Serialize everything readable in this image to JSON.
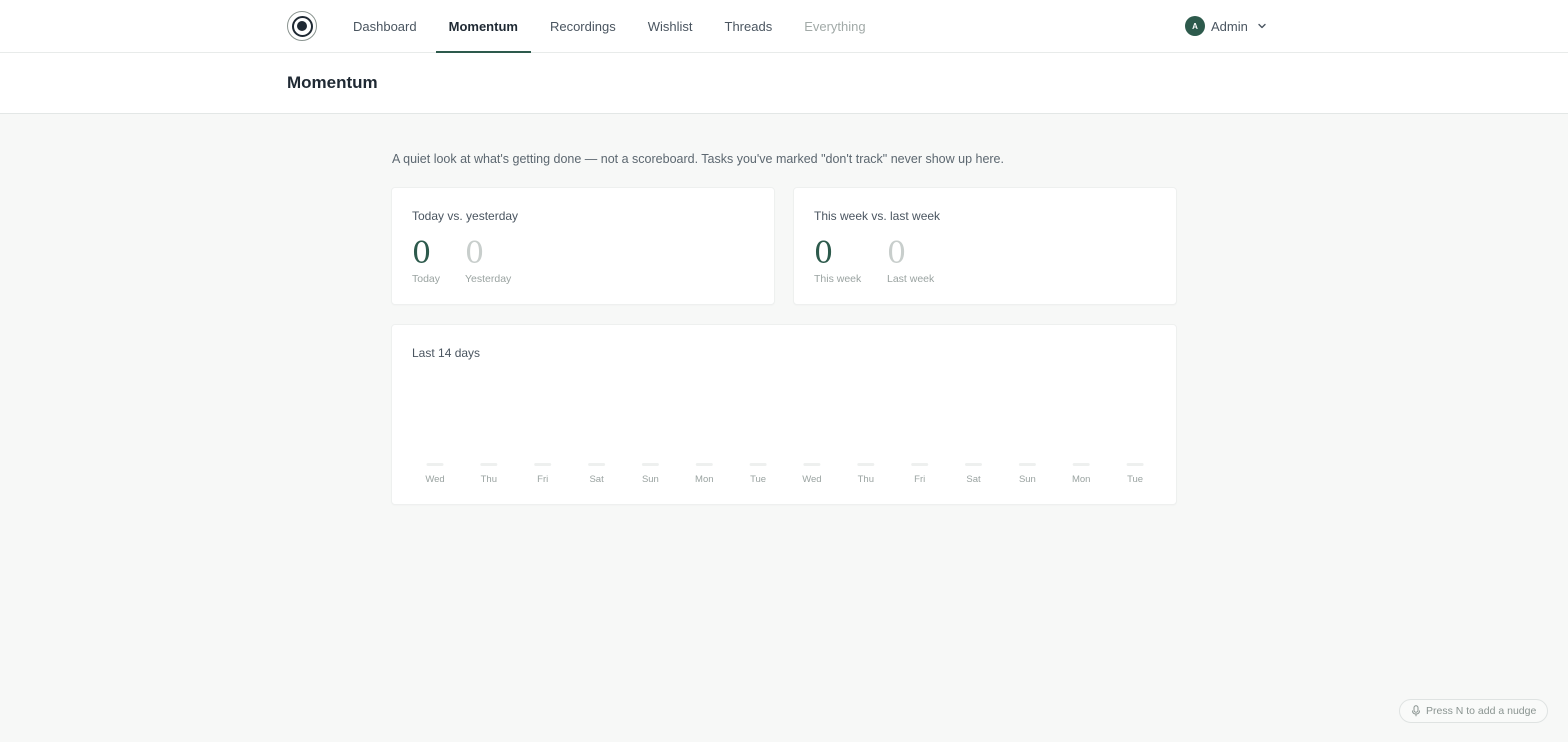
{
  "nav": {
    "items": [
      {
        "label": "Dashboard"
      },
      {
        "label": "Momentum",
        "active": true
      },
      {
        "label": "Recordings"
      },
      {
        "label": "Wishlist"
      },
      {
        "label": "Threads"
      },
      {
        "label": "Everything",
        "muted": true
      }
    ],
    "user": {
      "initial": "A",
      "name": "Admin"
    }
  },
  "page": {
    "title": "Momentum"
  },
  "intro": "A quiet look at what's getting done — not a scoreboard. Tasks you've marked \"don't track\" never show up here.",
  "daily": {
    "title": "Today vs. yesterday",
    "current": {
      "value": "0",
      "label": "Today"
    },
    "previous": {
      "value": "0",
      "label": "Yesterday"
    }
  },
  "weekly": {
    "title": "This week vs. last week",
    "current": {
      "value": "0",
      "label": "This week"
    },
    "previous": {
      "value": "0",
      "label": "Last week"
    }
  },
  "history": {
    "title": "Last 14 days"
  },
  "chart_data": {
    "type": "bar",
    "title": "Last 14 days",
    "categories": [
      "Wed",
      "Thu",
      "Fri",
      "Sat",
      "Sun",
      "Mon",
      "Tue",
      "Wed",
      "Thu",
      "Fri",
      "Sat",
      "Sun",
      "Mon",
      "Tue"
    ],
    "values": [
      0,
      0,
      0,
      0,
      0,
      0,
      0,
      0,
      0,
      0,
      0,
      0,
      0,
      0
    ],
    "xlabel": "",
    "ylabel": "",
    "grid": false,
    "colors": {
      "bar": "#2d5a4c",
      "empty_bar": "#eef0ef"
    }
  },
  "nudge": {
    "label": "Press N to add a nudge",
    "icon": "microphone-icon"
  },
  "colors": {
    "accent": "#2d5a4c",
    "muted_number": "#c8cecc",
    "background": "#f7f8f7"
  }
}
